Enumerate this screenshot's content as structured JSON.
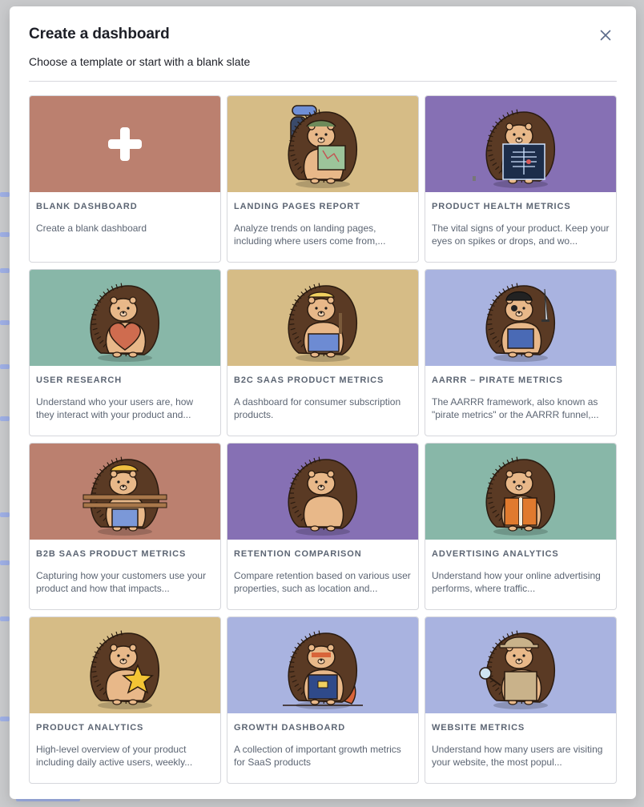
{
  "modal": {
    "title": "Create a dashboard",
    "subtitle": "Choose a template or start with a blank slate",
    "close_icon": "close-icon"
  },
  "colors": {
    "terracotta": "#bb806f",
    "sand": "#d6bc86",
    "purple": "#8670b4",
    "teal": "#88b7a8",
    "lavender": "#a9b3e0"
  },
  "templates": [
    {
      "title": "BLANK DASHBOARD",
      "desc": "Create a blank dashboard",
      "bg": "#bb806f",
      "art": "plus-icon"
    },
    {
      "title": "LANDING PAGES REPORT",
      "desc": "Analyze trends on landing pages, including where users come from,...",
      "bg": "#d6bc86",
      "art": "hedgehog-backpack-map"
    },
    {
      "title": "PRODUCT HEALTH METRICS",
      "desc": "The vital signs of your product. Keep your eyes on spikes or drops, and wo...",
      "bg": "#8670b4",
      "art": "hedgehog-xray"
    },
    {
      "title": "USER RESEARCH",
      "desc": "Understand who your users are, how they interact with your product and...",
      "bg": "#88b7a8",
      "art": "hedgehog-heart"
    },
    {
      "title": "B2C SAAS PRODUCT METRICS",
      "desc": "A dashboard for consumer subscription products.",
      "bg": "#d6bc86",
      "art": "hedgehog-overalls"
    },
    {
      "title": "AARRR – PIRATE METRICS",
      "desc": "The AARRR framework, also known as \"pirate metrics\" or the AARRR funnel,...",
      "bg": "#a9b3e0",
      "art": "hedgehog-pirate"
    },
    {
      "title": "B2B SAAS PRODUCT METRICS",
      "desc": "Capturing how your customers use your product and how that impacts...",
      "bg": "#bb806f",
      "art": "hedgehog-builder"
    },
    {
      "title": "RETENTION COMPARISON",
      "desc": "Compare retention based on various user properties, such as location and...",
      "bg": "#8670b4",
      "art": "hedgehog-plain"
    },
    {
      "title": "ADVERTISING ANALYTICS",
      "desc": "Understand how your online advertising performs, where traffic...",
      "bg": "#88b7a8",
      "art": "hedgehog-vest"
    },
    {
      "title": "PRODUCT ANALYTICS",
      "desc": "High-level overview of your product including daily active users, weekly...",
      "bg": "#d6bc86",
      "art": "hedgehog-star"
    },
    {
      "title": "GROWTH DASHBOARD",
      "desc": "A collection of important growth metrics for SaaS products",
      "bg": "#a9b3e0",
      "art": "hedgehog-superhero"
    },
    {
      "title": "WEBSITE METRICS",
      "desc": "Understand how many users are visiting your website, the most popul...",
      "bg": "#a9b3e0",
      "art": "hedgehog-detective"
    }
  ]
}
